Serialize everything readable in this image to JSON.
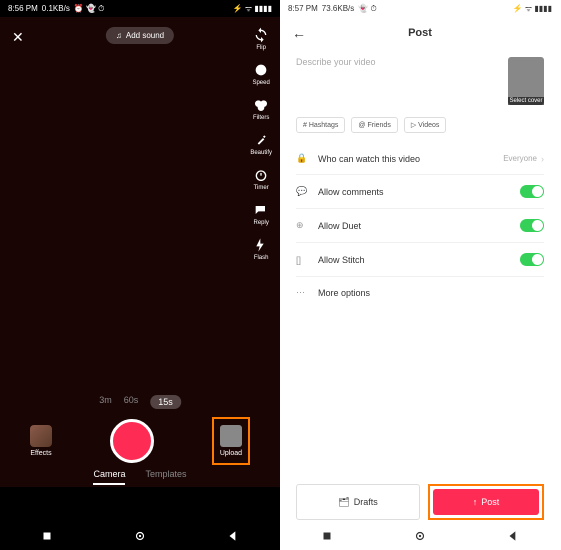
{
  "left": {
    "statusbar": {
      "time": "8:56 PM",
      "net": "0.1KB/s",
      "icons": "⏰ 👻 ⏱",
      "right": "⚡ ᯤ ▮▮▮▮"
    },
    "addSound": "Add sound",
    "tools": [
      "Flip",
      "Speed",
      "Filters",
      "Beautify",
      "Timer",
      "Reply",
      "Flash"
    ],
    "durations": [
      "3m",
      "60s",
      "15s"
    ],
    "durationActive": "15s",
    "effects": "Effects",
    "upload": "Upload",
    "modes": [
      "Camera",
      "Templates"
    ],
    "modeActive": "Camera"
  },
  "right": {
    "statusbar": {
      "time": "8:57 PM",
      "net": "73.6KB/s",
      "icons": "👻 ⏱",
      "right": "⚡ ᯤ ▮▮▮▮"
    },
    "title": "Post",
    "placeholder": "Describe your video",
    "coverLabel": "Select cover",
    "tags": [
      "# Hashtags",
      "@ Friends",
      "▷ Videos"
    ],
    "privacy": {
      "label": "Who can watch this video",
      "value": "Everyone"
    },
    "options": [
      {
        "icon": "💬",
        "label": "Allow comments",
        "on": true
      },
      {
        "icon": "⊕",
        "label": "Allow Duet",
        "on": true
      },
      {
        "icon": "[]",
        "label": "Allow Stitch",
        "on": true
      }
    ],
    "more": "More options",
    "drafts": "Drafts",
    "post": "Post"
  }
}
